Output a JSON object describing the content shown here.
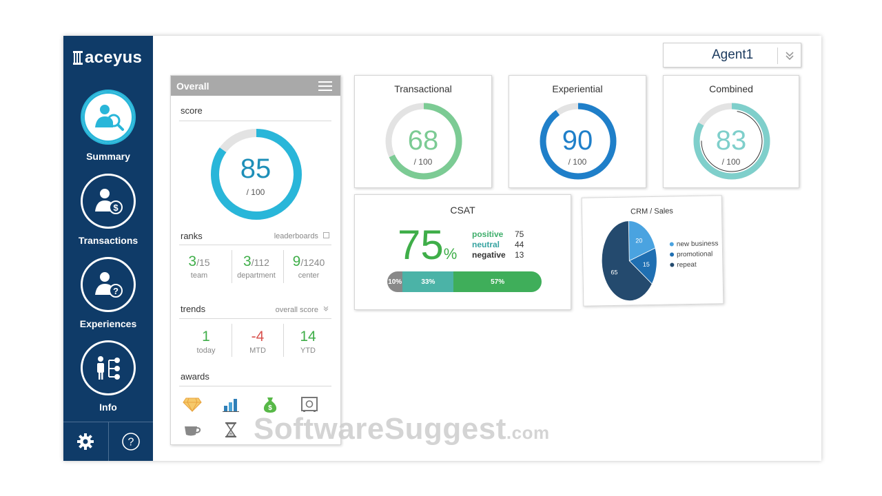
{
  "brand": {
    "logo": "aceyus"
  },
  "sidebar": {
    "items": [
      {
        "label": "Summary",
        "icon": "agent-search-icon",
        "active": true
      },
      {
        "label": "Transactions",
        "icon": "agent-dollar-icon",
        "active": false
      },
      {
        "label": "Experiences",
        "icon": "agent-question-icon",
        "active": false
      },
      {
        "label": "Info",
        "icon": "org-chart-icon",
        "active": false
      }
    ],
    "footer": {
      "settings_icon": "gear-icon",
      "help_icon": "question-icon"
    }
  },
  "agent_select": {
    "value": "Agent1"
  },
  "overall": {
    "title": "Overall",
    "score": {
      "label": "score",
      "value": "85",
      "max": "/ 100",
      "fraction": 0.85
    },
    "ranks": {
      "label": "ranks",
      "link": "leaderboards",
      "items": [
        {
          "value": "3",
          "total": "/15",
          "label": "team"
        },
        {
          "value": "3",
          "total": "/112",
          "label": "department"
        },
        {
          "value": "9",
          "total": "/1240",
          "label": "center"
        }
      ]
    },
    "trends": {
      "label": "trends",
      "select": "overall score",
      "items": [
        {
          "value": "1",
          "label": "today",
          "color": "#3fae49"
        },
        {
          "value": "-4",
          "label": "MTD",
          "color": "#d9534f"
        },
        {
          "value": "14",
          "label": "YTD",
          "color": "#3fae49"
        }
      ]
    },
    "awards": {
      "label": "awards",
      "icons": [
        "diamond-icon",
        "bar-chart-icon",
        "money-bag-icon",
        "safe-icon",
        "coffee-cup-icon",
        "hourglass-icon"
      ]
    }
  },
  "gauges": [
    {
      "title": "Transactional",
      "value": "68",
      "max": "/ 100",
      "fraction": 0.68,
      "color": "#7ccb94"
    },
    {
      "title": "Experiential",
      "value": "90",
      "max": "/ 100",
      "fraction": 0.9,
      "color": "#1f7fc9"
    },
    {
      "title": "Combined",
      "value": "83",
      "max": "/ 100",
      "fraction": 0.83,
      "color": "#7fcfcb"
    }
  ],
  "csat": {
    "title": "CSAT",
    "value": "75",
    "unit": "%",
    "rows": [
      {
        "label": "positive",
        "value": "75",
        "color": "#3fae6b"
      },
      {
        "label": "neutral",
        "value": "44",
        "color": "#35a3a0"
      },
      {
        "label": "negative",
        "value": "13",
        "color": "#333333"
      }
    ],
    "bar": [
      {
        "label": "10%",
        "fraction": 0.1,
        "color": "#888888"
      },
      {
        "label": "33%",
        "fraction": 0.33,
        "color": "#4bb3a7"
      },
      {
        "label": "57%",
        "fraction": 0.57,
        "color": "#3fae5a"
      }
    ]
  },
  "chart_data": {
    "type": "pie",
    "title": "CRM / Sales",
    "categories": [
      "new business",
      "promotional",
      "repeat"
    ],
    "values": [
      20,
      15,
      65
    ],
    "colors": [
      "#4aa3e0",
      "#1f6fb2",
      "#244a6e"
    ],
    "legend": "right"
  },
  "watermark": {
    "main": "SoftwareSuggest",
    "suffix": ".com"
  }
}
